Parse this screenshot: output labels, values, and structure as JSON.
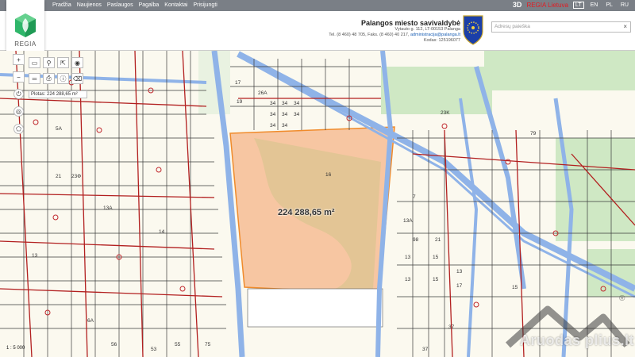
{
  "nav": {
    "items": [
      "Pradžia",
      "Naujienos",
      "Paslaugos",
      "Pagalba",
      "Kontaktai",
      "Prisijungti"
    ]
  },
  "top": {
    "btn_3d": "3D",
    "regia_lt": "REGIA Lietuva",
    "languages": [
      "LT",
      "EN",
      "PL",
      "RU"
    ],
    "active_language": "LT"
  },
  "logo": {
    "text": "REGIA"
  },
  "municipality": {
    "name": "Palangos miesto savivaldybė",
    "address": "Vytauto g. 112, LT-00153 Palanga",
    "phones": "Tel. (8 460) 48 705, Faks. (8 460) 40 217,",
    "email": "administracija@palanga.lt",
    "code": "Kodas: 125196077"
  },
  "search": {
    "placeholder": "Adresų paieška",
    "clear": "×"
  },
  "tools": {
    "zoom_in": "+",
    "zoom_out": "−",
    "area_readout": "Plotas: 224 288,65 m²"
  },
  "map": {
    "parcel_area_label": "224 288,65 m²",
    "scale": "1 : 5 000",
    "parcel_numbers": [
      "17",
      "26A",
      "34",
      "34",
      "34",
      "34",
      "34",
      "34",
      "34",
      "34",
      "19",
      "16",
      "7",
      "13",
      "13",
      "15",
      "15",
      "13",
      "17",
      "37",
      "75",
      "55",
      "53",
      "56",
      "6A",
      "5A",
      "21",
      "23Ф",
      "23K",
      "79",
      "13A",
      "98",
      "21",
      "37",
      "15",
      "13",
      "13A",
      "14"
    ],
    "colors": {
      "parcel_fill": "#f6b98e",
      "parcel_border": "#f08b2b",
      "road": "#8fb3e8",
      "boundary": "#b21f1f",
      "grid": "#3b3b3b"
    }
  },
  "watermark": {
    "text": "Aruodas plius.lt",
    "registered": "®"
  }
}
